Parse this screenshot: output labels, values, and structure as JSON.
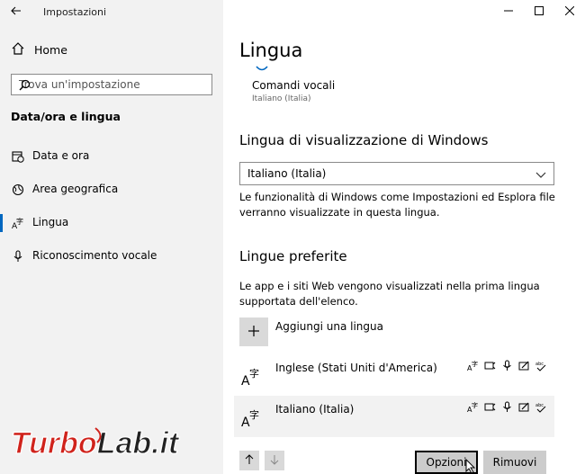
{
  "window": {
    "title": "Impostazioni",
    "controls": [
      "minimize-icon",
      "maximize-icon",
      "close-icon"
    ]
  },
  "sidebar": {
    "home_label": "Home",
    "search_placeholder": "Trova un'impostazione",
    "section_title": "Data/ora e lingua",
    "items": [
      {
        "label": "Data e ora",
        "icon": "calendar-clock-icon"
      },
      {
        "label": "Area geografica",
        "icon": "globe-icon"
      },
      {
        "label": "Lingua",
        "icon": "language-icon",
        "active": true
      },
      {
        "label": "Riconoscimento vocale",
        "icon": "microphone-icon"
      }
    ]
  },
  "main": {
    "title": "Lingua",
    "voice_commands": {
      "title": "Comandi vocali",
      "subtitle": "Italiano (Italia)"
    },
    "display_language": {
      "heading": "Lingua di visualizzazione di Windows",
      "selected": "Italiano (Italia)",
      "description": "Le funzionalità di Windows come Impostazioni ed Esplora file verranno visualizzate in questa lingua."
    },
    "preferred": {
      "heading": "Lingue preferite",
      "description": "Le app e i siti Web vengono visualizzati nella prima lingua supportata dell'elenco.",
      "add_label": "Aggiungi una lingua",
      "languages": [
        {
          "name": "Inglese (Stati Uniti d'America)",
          "selected": false
        },
        {
          "name": "Italiano (Italia)",
          "selected": true
        }
      ],
      "options_label": "Opzioni",
      "remove_label": "Rimuovi"
    }
  },
  "watermark": {
    "text_part1": "Turbo",
    "text_part2": "Lab.it"
  },
  "colors": {
    "accent": "#0067c0",
    "sidebar_bg": "#f2f2f2",
    "button_bg": "#cccccc",
    "watermark_red": "#d0231c"
  }
}
